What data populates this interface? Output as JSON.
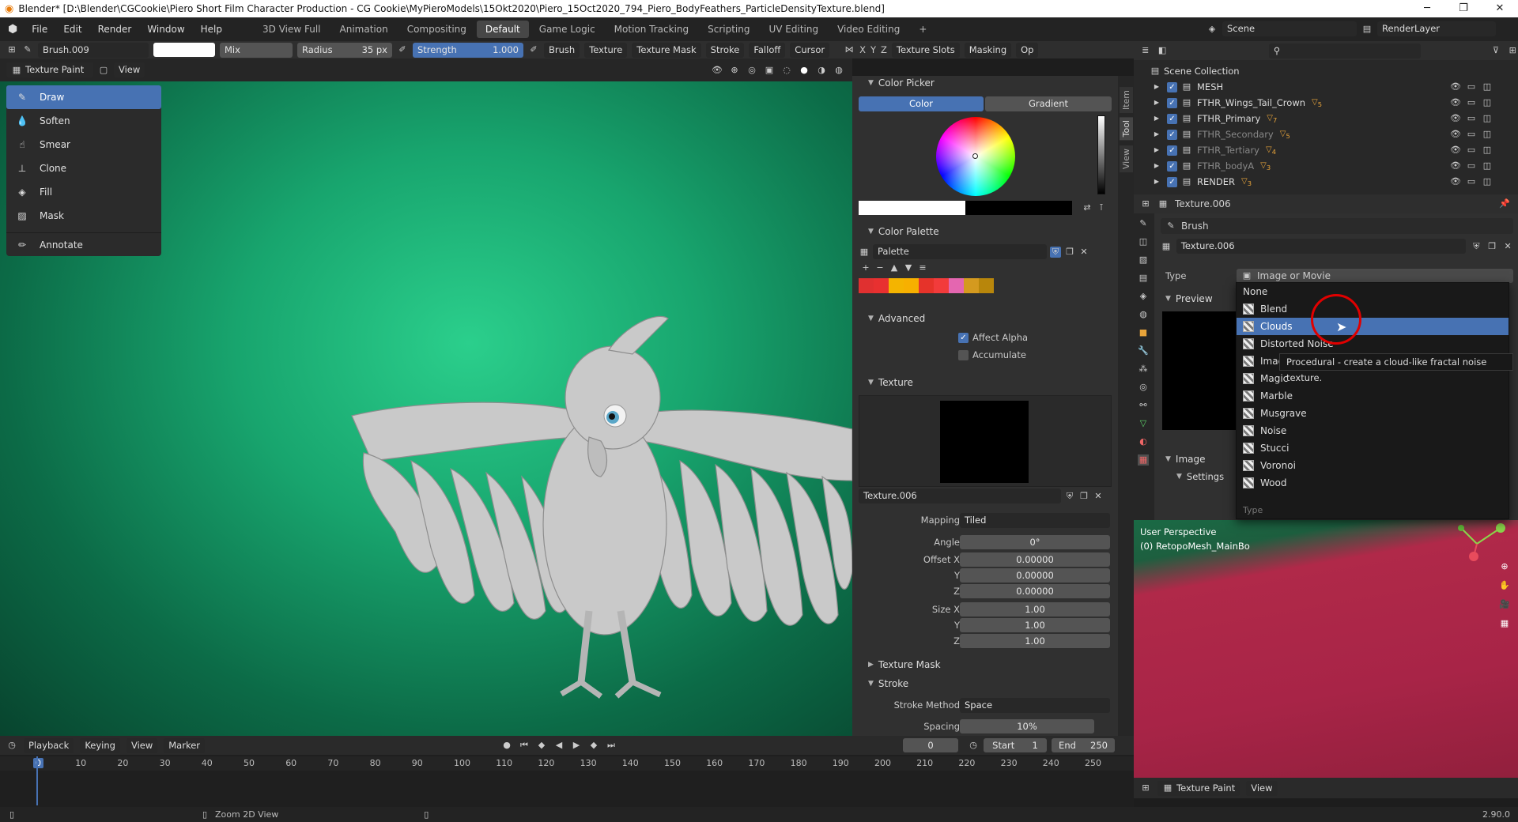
{
  "window": {
    "title": "Blender* [D:\\Blender\\CGCookie\\Piero Short Film Character Production - CG Cookie\\MyPieroModels\\15Okt2020\\Piero_15Oct2020_794_Piero_BodyFeathers_ParticleDensityTexture.blend]",
    "minimize": "─",
    "restore": "❐",
    "close": "✕"
  },
  "menu": {
    "items": [
      "File",
      "Edit",
      "Render",
      "Window",
      "Help"
    ]
  },
  "workspaces": {
    "tabs": [
      "3D View Full",
      "Animation",
      "Compositing",
      "Default",
      "Game Logic",
      "Motion Tracking",
      "Scripting",
      "UV Editing",
      "Video Editing"
    ],
    "active": "Default",
    "add": "+"
  },
  "scene": {
    "name": "Scene",
    "renderlayer": "RenderLayer"
  },
  "tool_header": {
    "brush": "Brush.009",
    "blend": "Mix",
    "radius_label": "Radius",
    "radius_value": "35 px",
    "strength_label": "Strength",
    "strength_value": "1.000",
    "menus": [
      "Brush",
      "Texture",
      "Texture Mask",
      "Stroke",
      "Falloff",
      "Cursor"
    ],
    "xyz": [
      "X",
      "Y",
      "Z"
    ],
    "right_menus": [
      "Texture Slots",
      "Masking",
      "Op"
    ]
  },
  "viewport_header": {
    "mode": "Texture Paint",
    "view": "View"
  },
  "tools": [
    {
      "label": "Draw",
      "icon": "brush-icon",
      "active": true
    },
    {
      "label": "Soften",
      "icon": "drop-icon"
    },
    {
      "label": "Smear",
      "icon": "smear-icon"
    },
    {
      "label": "Clone",
      "icon": "stamp-icon"
    },
    {
      "label": "Fill",
      "icon": "fill-icon"
    },
    {
      "label": "Mask",
      "icon": "mask-icon"
    },
    {
      "label": "Annotate",
      "icon": "annotate-icon"
    }
  ],
  "sidebar_tabs": [
    "Item",
    "Tool",
    "View"
  ],
  "color_picker": {
    "title": "Color Picker",
    "tab_color": "Color",
    "tab_gradient": "Gradient"
  },
  "color_palette": {
    "title": "Color Palette",
    "name": "Palette",
    "swatches": [
      "#e03030",
      "#e83030",
      "#f4b400",
      "#f7b000",
      "#e6332a",
      "#f23b3b",
      "#e466b0",
      "#d49a1f",
      "#b8860b"
    ]
  },
  "advanced": {
    "title": "Advanced",
    "affect_alpha": "Affect Alpha",
    "accumulate": "Accumulate"
  },
  "texture": {
    "title": "Texture",
    "name": "Texture.006",
    "mapping_label": "Mapping",
    "mapping_value": "Tiled",
    "angle_label": "Angle",
    "angle_value": "0°",
    "offset_x_label": "Offset X",
    "offset_x": "0.00000",
    "y_label": "Y",
    "offset_y": "0.00000",
    "z_label": "Z",
    "offset_z": "0.00000",
    "size_x_label": "Size X",
    "size_x": "1.00",
    "size_y": "1.00",
    "size_z": "1.00"
  },
  "texture_mask": {
    "title": "Texture Mask"
  },
  "stroke": {
    "title": "Stroke",
    "method_label": "Stroke Method",
    "method_value": "Space",
    "spacing_label": "Spacing",
    "spacing_value": "10%"
  },
  "outliner": {
    "root": "Scene Collection",
    "rows": [
      {
        "name": "MESH",
        "badge": ""
      },
      {
        "name": "FTHR_Wings_Tail_Crown",
        "badge": "5"
      },
      {
        "name": "FTHR_Primary",
        "badge": "7"
      },
      {
        "name": "FTHR_Secondary",
        "badge": "5"
      },
      {
        "name": "FTHR_Tertiary",
        "badge": "4"
      },
      {
        "name": "FTHR_bodyA",
        "badge": "3"
      },
      {
        "name": "RENDER",
        "badge": "3"
      }
    ]
  },
  "properties": {
    "datablock": "Texture.006",
    "context": "Brush",
    "texture_name": "Texture.006",
    "type_label": "Type",
    "type_value": "Image or Movie",
    "preview_label": "Preview",
    "image_label": "Image",
    "settings_label": "Settings"
  },
  "type_dropdown": {
    "options": [
      "None",
      "Blend",
      "Clouds",
      "Distorted Noise",
      "Image or Movie",
      "Magic",
      "Marble",
      "Musgrave",
      "Noise",
      "Stucci",
      "Voronoi",
      "Wood"
    ],
    "selected": "Clouds",
    "footer": "Type"
  },
  "tooltip": {
    "text": "Procedural - create a cloud-like fractal noise texture."
  },
  "viewport2": {
    "perspective": "User Perspective",
    "object": "(0) RetopoMesh_MainBo",
    "mode": "Texture Paint",
    "view": "View"
  },
  "timeline": {
    "menus": [
      "Playback",
      "Keying",
      "View",
      "Marker"
    ],
    "current_frame": "0",
    "start_label": "Start",
    "start": "1",
    "end_label": "End",
    "end": "250",
    "ticks": [
      "0",
      "10",
      "20",
      "30",
      "40",
      "50",
      "60",
      "70",
      "80",
      "90",
      "100",
      "110",
      "120",
      "130",
      "140",
      "150",
      "160",
      "170",
      "180",
      "190",
      "200",
      "210",
      "220",
      "230",
      "240",
      "250"
    ]
  },
  "statusbar": {
    "hint": "Zoom 2D View",
    "version": "2.90.0"
  }
}
